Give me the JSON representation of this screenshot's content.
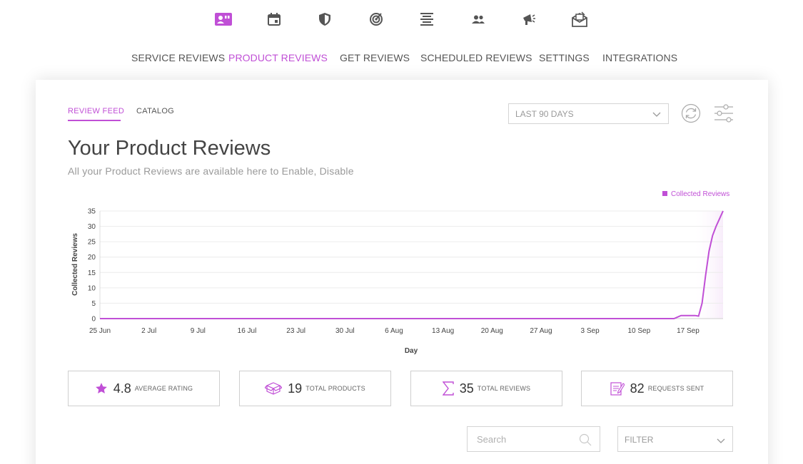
{
  "colors": {
    "accent": "#c04fd6",
    "icon": "#555555"
  },
  "top_icons": [
    "reviews-icon",
    "calendar-icon",
    "shield-icon",
    "target-icon",
    "align-center-icon",
    "users-icon",
    "megaphone-icon",
    "envelope-icon"
  ],
  "nav": {
    "items": [
      "SERVICE REVIEWS",
      "PRODUCT REVIEWS",
      "GET REVIEWS",
      "SCHEDULED REVIEWS",
      "SETTINGS",
      "INTEGRATIONS"
    ],
    "active": "PRODUCT REVIEWS"
  },
  "subtabs": {
    "items": [
      "REVIEW FEED",
      "CATALOG"
    ],
    "active": "REVIEW FEED"
  },
  "range_select": {
    "value": "LAST 90 DAYS"
  },
  "page": {
    "title": "Your Product Reviews",
    "subtitle": "All your Product Reviews are available here to Enable, Disable"
  },
  "chart_data": {
    "type": "line",
    "xlabel": "Day",
    "ylabel": "Collected Reviews",
    "ylim": [
      0,
      35
    ],
    "y_ticks": [
      0,
      5,
      10,
      15,
      20,
      25,
      30,
      35
    ],
    "x_ticks": [
      "25 Jun",
      "2 Jul",
      "9 Jul",
      "16 Jul",
      "23 Jul",
      "30 Jul",
      "6 Aug",
      "13 Aug",
      "20 Aug",
      "27 Aug",
      "3 Sep",
      "10 Sep",
      "17 Sep"
    ],
    "x_range_days": [
      0,
      89
    ],
    "grid": true,
    "legend_position": "top-right",
    "series": [
      {
        "name": "Collected Reviews",
        "color": "#c04fd6",
        "points": [
          [
            0,
            0
          ],
          [
            10,
            0
          ],
          [
            20,
            0
          ],
          [
            30,
            0
          ],
          [
            40,
            0
          ],
          [
            50,
            0
          ],
          [
            60,
            0
          ],
          [
            70,
            0
          ],
          [
            80,
            0
          ],
          [
            82,
            0
          ],
          [
            83,
            1
          ],
          [
            84,
            1
          ],
          [
            85,
            1
          ],
          [
            85.5,
            0.8
          ],
          [
            86,
            5
          ],
          [
            86.5,
            14
          ],
          [
            87,
            22
          ],
          [
            87.5,
            27
          ],
          [
            88,
            30
          ],
          [
            88.5,
            32.5
          ],
          [
            89,
            35
          ]
        ]
      }
    ]
  },
  "stats": [
    {
      "icon": "star-icon",
      "value": "4.8",
      "label": "AVERAGE RATING"
    },
    {
      "icon": "box-icon",
      "value": "19",
      "label": "TOTAL PRODUCTS"
    },
    {
      "icon": "sigma-icon",
      "value": "35",
      "label": "TOTAL REVIEWS"
    },
    {
      "icon": "edit-document-icon",
      "value": "82",
      "label": "REQUESTS SENT"
    }
  ],
  "search": {
    "placeholder": "Search"
  },
  "filter": {
    "value": "FILTER"
  }
}
